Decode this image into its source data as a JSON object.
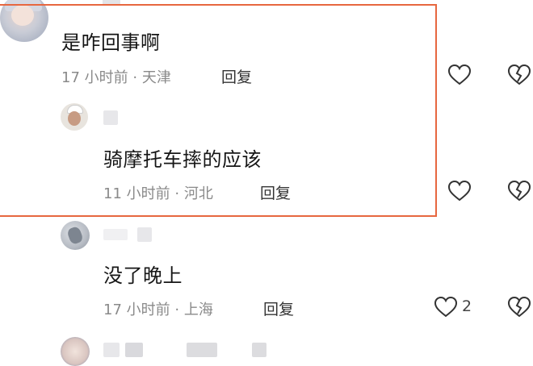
{
  "comments": [
    {
      "text": "是咋回事啊",
      "time": "17 小时前",
      "location": "天津",
      "reply_label": "回复"
    },
    {
      "text": "骑摩托车摔的应该",
      "time": "11 小时前",
      "location": "河北",
      "reply_label": "回复"
    },
    {
      "text": "没了晚上",
      "time": "17 小时前",
      "location": "上海",
      "reply_label": "回复",
      "like_count": "2"
    }
  ],
  "meta_separator": "·",
  "icons": {
    "like": "heart-outline-icon",
    "dislike": "broken-heart-icon"
  },
  "colors": {
    "highlight_border": "#e7673f",
    "meta_text": "#8a8a8a"
  }
}
